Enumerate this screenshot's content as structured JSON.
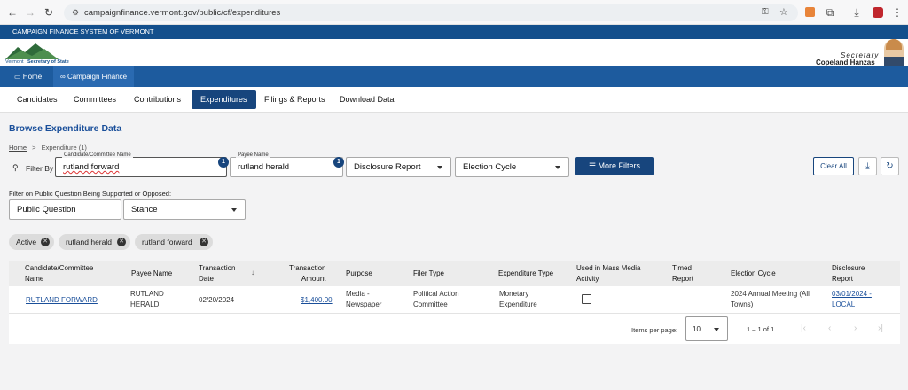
{
  "browser": {
    "url": "campaignfinance.vermont.gov/public/cf/expenditures"
  },
  "site": {
    "banner": "CAMPAIGN FINANCE SYSTEM OF VERMONT",
    "logo_text_1": "Vermont",
    "logo_text_2": "Secretary of State",
    "secretary_title": "Secretary",
    "secretary_name": "Copeland Hanzas"
  },
  "nav": {
    "home": "Home",
    "campaign_finance": "Campaign Finance"
  },
  "subnav": [
    "Candidates",
    "Committees",
    "Contributions",
    "Expenditures",
    "Filings & Reports",
    "Download Data"
  ],
  "page": {
    "title": "Browse Expenditure Data",
    "breadcrumb_home": "Home",
    "breadcrumb_sep": ">",
    "breadcrumb_current": "Expenditure (1)"
  },
  "filters": {
    "filter_by": "Filter By",
    "candidate_label": "Candidate/Committee Name",
    "candidate_value": "rutland forward",
    "candidate_count": "1",
    "payee_label": "Payee Name",
    "payee_value": "rutland herald",
    "payee_count": "1",
    "disclosure_placeholder": "Disclosure Report",
    "cycle_placeholder": "Election Cycle",
    "more_filters": "More Filters",
    "clear_all": "Clear All",
    "question_label": "Filter on Public Question Being Supported or Opposed:",
    "question_placeholder": "Public Question",
    "stance_placeholder": "Stance"
  },
  "chips": [
    "Active",
    "rutland herald",
    "rutland forward"
  ],
  "table": {
    "headers": {
      "candidate": [
        "Candidate/Committee",
        "Name"
      ],
      "payee": "Payee Name",
      "date": [
        "Transaction",
        "Date"
      ],
      "amount": [
        "Transaction",
        "Amount"
      ],
      "purpose": "Purpose",
      "filer": "Filer Type",
      "exp_type": "Expenditure Type",
      "mass_media": [
        "Used in Mass Media",
        "Activity"
      ],
      "timed": [
        "Timed",
        "Report"
      ],
      "cycle": "Election Cycle",
      "disclosure": [
        "Disclosure",
        "Report"
      ]
    },
    "row": {
      "candidate": "RUTLAND FORWARD",
      "payee": [
        "RUTLAND",
        "HERALD"
      ],
      "date": "02/20/2024",
      "amount": "$1,400.00",
      "purpose": [
        "Media -",
        "Newspaper"
      ],
      "filer": [
        "Political Action",
        "Committee"
      ],
      "exp_type": [
        "Monetary",
        "Expenditure"
      ],
      "cycle": [
        "2024 Annual Meeting (All",
        "Towns)"
      ],
      "disclosure": [
        "03/01/2024 -",
        "LOCAL"
      ]
    }
  },
  "pagination": {
    "items_label": "Items per page:",
    "page_size": "10",
    "range": "1 – 1 of 1"
  },
  "colors": {
    "banner": "#134f8c",
    "nav": "#1d5b9e",
    "accent": "#17457d"
  }
}
